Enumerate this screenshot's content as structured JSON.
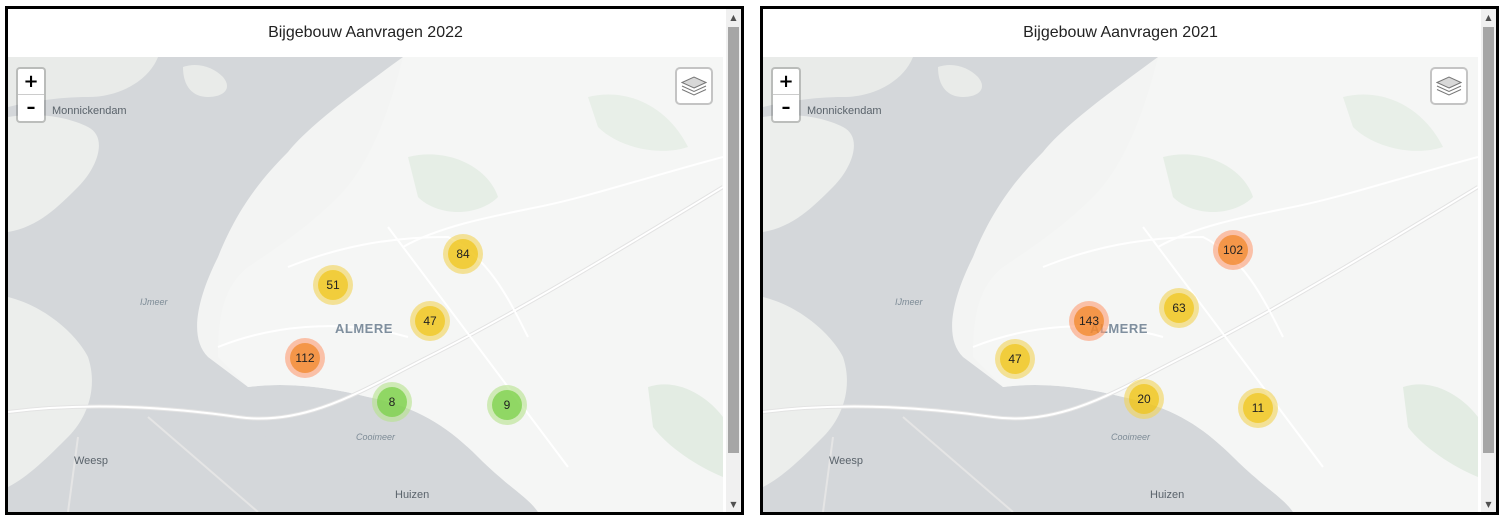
{
  "panels": [
    {
      "title": "Bijgebouw Aanvragen 2022",
      "zoom_in_label": "+",
      "zoom_out_label": "–",
      "clusters": [
        {
          "count": "84",
          "level": "medium"
        },
        {
          "count": "51",
          "level": "medium"
        },
        {
          "count": "47",
          "level": "medium"
        },
        {
          "count": "112",
          "level": "large"
        },
        {
          "count": "8",
          "level": "small"
        },
        {
          "count": "9",
          "level": "small"
        }
      ]
    },
    {
      "title": "Bijgebouw Aanvragen 2021",
      "zoom_in_label": "+",
      "zoom_out_label": "–",
      "clusters": [
        {
          "count": "102",
          "level": "large"
        },
        {
          "count": "63",
          "level": "medium"
        },
        {
          "count": "143",
          "level": "large"
        },
        {
          "count": "47",
          "level": "medium"
        },
        {
          "count": "20",
          "level": "medium"
        },
        {
          "count": "11",
          "level": "medium"
        }
      ]
    }
  ],
  "place_labels": {
    "monnickendam": "Monnickendam",
    "ijmeer": "IJmeer",
    "almere": "ALMERE",
    "cooimeer": "Cooimeer",
    "weesp": "Weesp",
    "huizen": "Huizen"
  },
  "cluster_colors": {
    "small": "#6ecc39",
    "medium": "#f0c20c",
    "large": "#f18017"
  },
  "icons": {
    "layers": "layers-icon",
    "scroll_up": "scroll-up-arrow-icon",
    "scroll_down": "scroll-down-arrow-icon"
  }
}
